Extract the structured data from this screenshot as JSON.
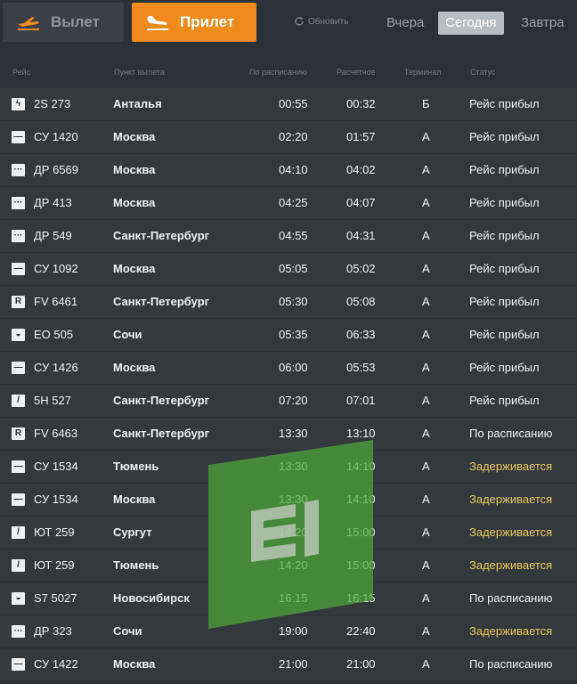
{
  "tabs": {
    "departures": "Вылет",
    "arrivals": "Прилет"
  },
  "refresh_label": "Обновить",
  "days": [
    "Вчера",
    "Сегодня",
    "Завтра"
  ],
  "columns": [
    "Рейс",
    "Пункт вылета",
    "По расписанию",
    "Расчетное",
    "Терминал",
    "Статус"
  ],
  "colors": {
    "accent": "#f08a1c",
    "delayed": "#e6c75a",
    "watermark": "#4fa83a"
  },
  "rows": [
    {
      "flight": "2S 273",
      "city": "Анталья",
      "sched": "00:55",
      "est": "00:32",
      "terminal": "Б",
      "status": "Рейс прибыл",
      "delayed": false,
      "logo": "lightning-logo-icon"
    },
    {
      "flight": "СУ 1420",
      "city": "Москва",
      "sched": "02:20",
      "est": "01:57",
      "terminal": "А",
      "status": "Рейс прибыл",
      "delayed": false,
      "logo": "stripe-logo-icon"
    },
    {
      "flight": "ДР 6569",
      "city": "Москва",
      "sched": "04:10",
      "est": "04:02",
      "terminal": "А",
      "status": "Рейс прибыл",
      "delayed": false,
      "logo": "dots-logo-icon"
    },
    {
      "flight": "ДР 413",
      "city": "Москва",
      "sched": "04:25",
      "est": "04:07",
      "terminal": "А",
      "status": "Рейс прибыл",
      "delayed": false,
      "logo": "dots-logo-icon"
    },
    {
      "flight": "ДР 549",
      "city": "Санкт-Петербург",
      "sched": "04:55",
      "est": "04:31",
      "terminal": "А",
      "status": "Рейс прибыл",
      "delayed": false,
      "logo": "dots-logo-icon"
    },
    {
      "flight": "СУ 1092",
      "city": "Москва",
      "sched": "05:05",
      "est": "05:02",
      "terminal": "А",
      "status": "Рейс прибыл",
      "delayed": false,
      "logo": "stripe-logo-icon"
    },
    {
      "flight": "FV 6461",
      "city": "Санкт-Петербург",
      "sched": "05:30",
      "est": "05:08",
      "terminal": "А",
      "status": "Рейс прибыл",
      "delayed": false,
      "logo": "r-logo-icon"
    },
    {
      "flight": "EO 505",
      "city": "Сочи",
      "sched": "05:35",
      "est": "06:33",
      "terminal": "А",
      "status": "Рейс прибыл",
      "delayed": false,
      "logo": "circle-logo-icon"
    },
    {
      "flight": "СУ 1426",
      "city": "Москва",
      "sched": "06:00",
      "est": "05:53",
      "terminal": "А",
      "status": "Рейс прибыл",
      "delayed": false,
      "logo": "stripe-logo-icon"
    },
    {
      "flight": "5Н 527",
      "city": "Санкт-Петербург",
      "sched": "07:20",
      "est": "07:01",
      "terminal": "А",
      "status": "Рейс прибыл",
      "delayed": false,
      "logo": "slash-logo-icon"
    },
    {
      "flight": "FV 6463",
      "city": "Санкт-Петербург",
      "sched": "13:30",
      "est": "13:10",
      "terminal": "А",
      "status": "По расписанию",
      "delayed": false,
      "logo": "r-logo-icon"
    },
    {
      "flight": "СУ 1534",
      "city": "Тюмень",
      "sched": "13:30",
      "est": "14:10",
      "terminal": "А",
      "status": "Задерживается",
      "delayed": true,
      "logo": "stripe-logo-icon"
    },
    {
      "flight": "СУ 1534",
      "city": "Москва",
      "sched": "13:30",
      "est": "14:10",
      "terminal": "А",
      "status": "Задерживается",
      "delayed": true,
      "logo": "stripe-logo-icon"
    },
    {
      "flight": "ЮТ 259",
      "city": "Сургут",
      "sched": "14:20",
      "est": "15:00",
      "terminal": "А",
      "status": "Задерживается",
      "delayed": true,
      "logo": "slash-logo-icon"
    },
    {
      "flight": "ЮТ 259",
      "city": "Тюмень",
      "sched": "14:20",
      "est": "15:00",
      "terminal": "А",
      "status": "Задерживается",
      "delayed": true,
      "logo": "slash-logo-icon"
    },
    {
      "flight": "S7 5027",
      "city": "Новосибирск",
      "sched": "16:15",
      "est": "16:15",
      "terminal": "А",
      "status": "По расписанию",
      "delayed": false,
      "logo": "circle-logo-icon"
    },
    {
      "flight": "ДР 323",
      "city": "Сочи",
      "sched": "19:00",
      "est": "22:40",
      "terminal": "А",
      "status": "Задерживается",
      "delayed": true,
      "logo": "dots-logo-icon"
    },
    {
      "flight": "СУ 1422",
      "city": "Москва",
      "sched": "21:00",
      "est": "21:00",
      "terminal": "А",
      "status": "По расписанию",
      "delayed": false,
      "logo": "stripe-logo-icon"
    }
  ]
}
